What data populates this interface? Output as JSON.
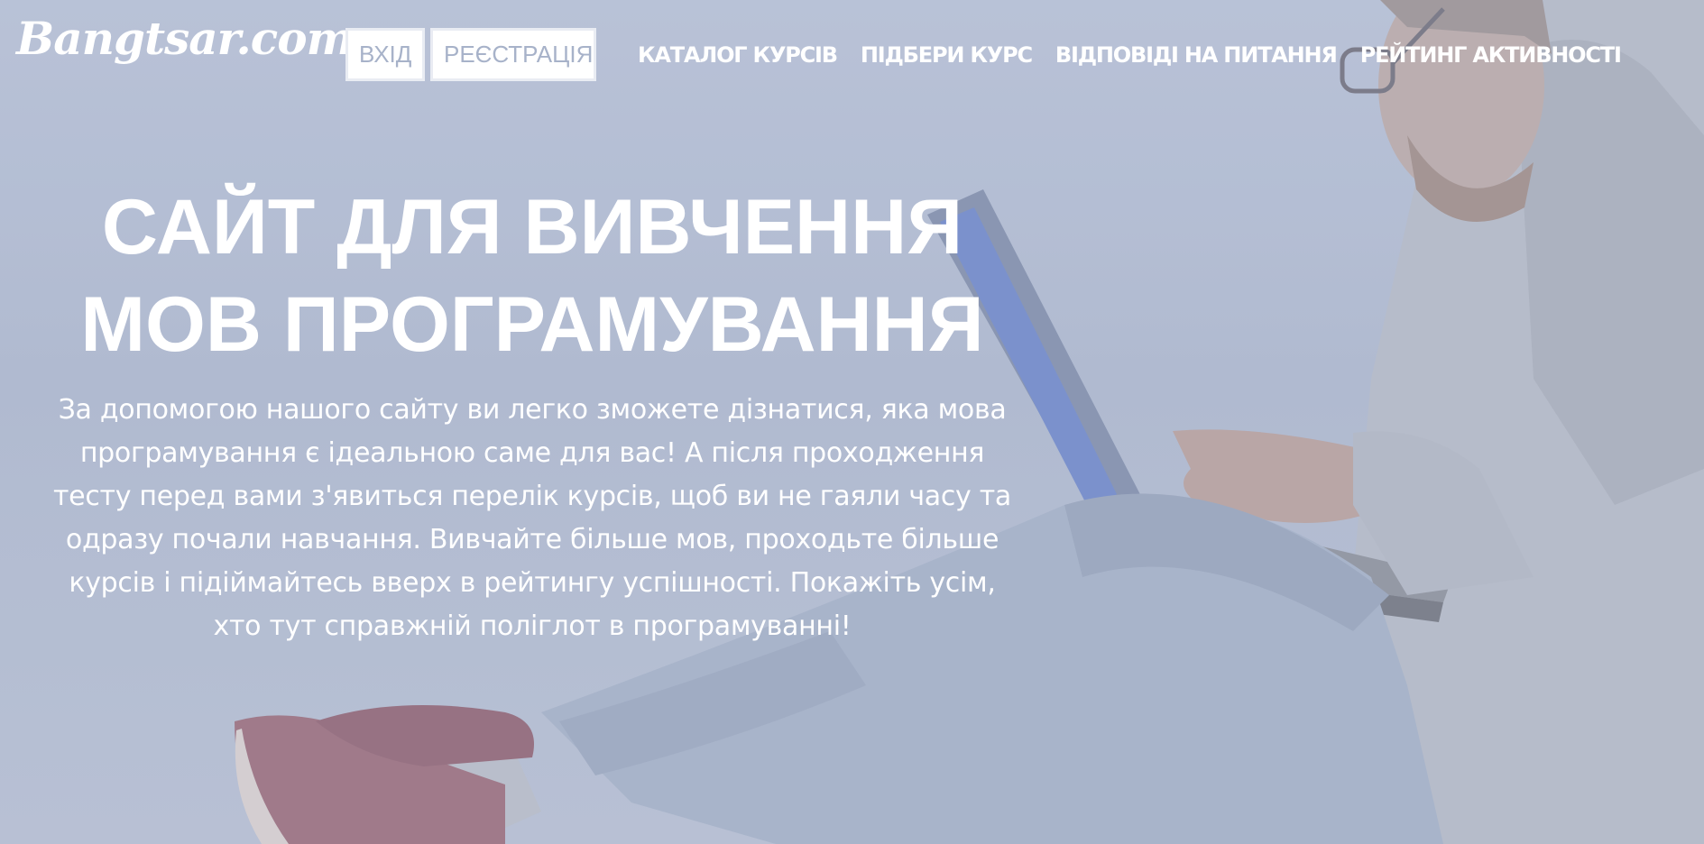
{
  "header": {
    "logo": "Bangtsar.com",
    "login_label": "ВХІД",
    "register_label": "РЕЄСТРАЦІЯ",
    "nav": [
      {
        "label": "КАТАЛОГ КУРСІВ"
      },
      {
        "label": "ПІДБЕРИ КУРС"
      },
      {
        "label": "ВІДПОВІДІ НА ПИТАННЯ"
      },
      {
        "label": "РЕЙТИНГ АКТИВНОСТІ"
      }
    ]
  },
  "hero": {
    "title_line1": "САЙТ ДЛЯ ВИВЧЕННЯ",
    "title_line2": "МОВ ПРОГРАМУВАННЯ",
    "description": "За допомогою нашого сайту ви легко зможете дізнатися, яка мова програмування є ідеальною саме для вас! А після проходження тесту перед вами з'явиться перелік курсів, щоб ви не гаяли часу та одразу почали навчання. Вивчайте більше мов, проходьте більше курсів і підіймайтесь вверх в рейтингу успішності. Покажіть усім, хто тут справжній поліглот в програмуванні!"
  },
  "colors": {
    "background": "#aeb8cf",
    "text": "#ffffff",
    "button_text": "#a7b2c9"
  }
}
